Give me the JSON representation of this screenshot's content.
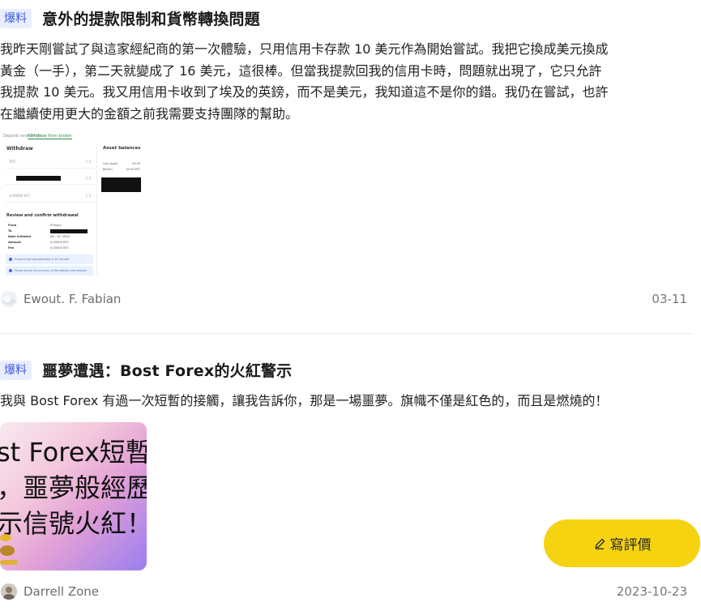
{
  "posts": [
    {
      "tag": "爆料",
      "title": "意外的提款限制和貨幣轉換問題",
      "body_lines": [
        "我昨天剛嘗試了與這家經紀商的第一次體驗，只用信用卡存款 10 美元作為開始嘗試。我把它換成美元換成",
        "黃金（一手），第二天就變成了 16 美元，這很棒。但當我提款回我的信用卡時，問題就出現了，它只允許",
        "我提款 10 美元。我又用信用卡收到了埃及的英鎊，而不是美元，我知道這不是你的錯。我仍在嘗試，也許",
        "在繼續使用更大的金額之前我需要支持團隊的幫助。"
      ],
      "screenshot": {
        "tabs": [
          "Deposit over limits",
          "Withdraw from broker"
        ],
        "panel_title": "Withdraw",
        "rows": [
          {
            "label": "BTC",
            "value": "1 3"
          },
          {
            "label": "",
            "value": "1 3"
          },
          {
            "label": "8.66666 BTC",
            "value": "1 2"
          }
        ],
        "review_title": "Review and confirm withdrawal",
        "fields": [
          {
            "k": "From",
            "v": "Primary"
          },
          {
            "k": "To",
            "v": ""
          },
          {
            "k": "Date initiated",
            "v": "Jan. 14, 2024"
          },
          {
            "k": "Amount",
            "v": "0.00000 BTC"
          },
          {
            "k": "Fee",
            "v": "0.00000 BTC"
          }
        ],
        "notes": [
          "Funds arrival approximately in 30 minutes",
          "Please ensure the accuracy of the address and network"
        ],
        "asset_title": "Asset balances",
        "assets": [
          {
            "k": "Coin Asset",
            "v": "$0.00"
          },
          {
            "k": "Bitcoin",
            "v": "$0.00 BTC"
          }
        ]
      },
      "author": "Ewout. F. Fabian",
      "date": "03-11"
    },
    {
      "tag": "爆料",
      "title": "噩夢遭遇：Bost Forex的火紅警示",
      "body_lines": [
        "我與 Bost Forex 有過一次短暫的接觸，讓我告訴你，那是一場噩夢。旗幟不僅是紅色的，而且是燃燒的！"
      ],
      "image_lines": [
        "st Forex短暫",
        "，噩夢般經歷",
        "示信號火紅！"
      ],
      "author": "Darrell Zone",
      "date": "2023-10-23"
    }
  ],
  "review_button": {
    "label": "寫評價",
    "icon": "pencil-icon",
    "color": "#f5d311"
  },
  "colors": {
    "tag_bg": "#e9eeff",
    "tag_text": "#3d5bd9"
  }
}
